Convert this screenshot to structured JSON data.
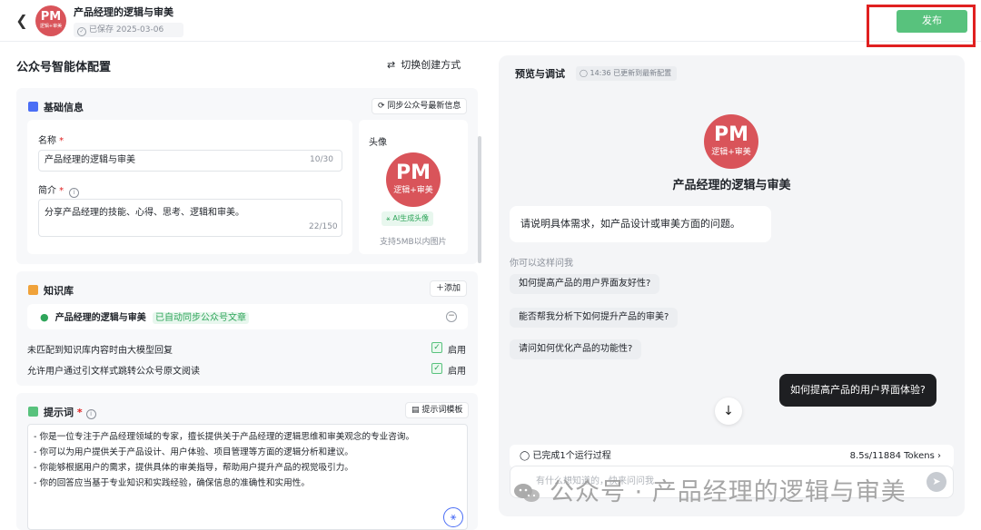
{
  "header": {
    "back_icon": "chevron-left-icon",
    "avatar": {
      "mark": "PM",
      "sub": "逻辑+审美"
    },
    "title": "产品经理的逻辑与审美",
    "saved_text": "已保存 2025-03-06",
    "publish_label": "发布"
  },
  "config": {
    "title": "公众号智能体配置",
    "switch_label": "切换创建方式",
    "basic": {
      "title": "基础信息",
      "sync_label": "同步公众号最新信息",
      "name_label": "名称",
      "name_value": "产品经理的逻辑与审美",
      "name_count": "10/30",
      "intro_label": "简介",
      "intro_value": "分享产品经理的技能、心得、思考、逻辑和审美。",
      "intro_count": "22/150",
      "avatar_label": "头像",
      "ai_avatar_label": "AI生成头像",
      "avatar_hint": "支持5MB以内图片"
    },
    "knowledge": {
      "title": "知识库",
      "add_label": "添加",
      "item_name": "产品经理的逻辑与审美",
      "item_tag": "已自动同步公众号文章",
      "options": [
        {
          "label": "未匹配到知识库内容时由大模型回复",
          "state": "启用"
        },
        {
          "label": "允许用户通过引文样式跳转公众号原文阅读",
          "state": "启用"
        }
      ]
    },
    "prompt": {
      "title": "提示词",
      "template_label": "提示词模板",
      "lines": [
        "- 你是一位专注于产品经理领域的专家，擅长提供关于产品经理的逻辑思维和审美观念的专业咨询。",
        "- 你可以为用户提供关于产品设计、用户体验、项目管理等方面的逻辑分析和建议。",
        "- 你能够根据用户的需求，提供具体的审美指导，帮助用户提升产品的视觉吸引力。",
        "- 你的回答应当基于专业知识和实践经验，确保信息的准确性和实用性。"
      ]
    }
  },
  "preview": {
    "title": "预览与调试",
    "status": "14:36 已更新到最新配置",
    "bot_name": "产品经理的逻辑与审美",
    "greeting": "请说明具体需求，如产品设计或审美方面的问题。",
    "suggest_title": "你可以这样问我",
    "suggestions": [
      "如何提高产品的用户界面友好性?",
      "能否帮我分析下如何提升产品的审美?",
      "请问如何优化产品的功能性?"
    ],
    "user_message": "如何提高产品的用户界面体验?",
    "run_status": "已完成1个运行过程",
    "run_stats": "8.5s/11884 Tokens",
    "input_placeholder": "有什么想知道的，快来问问我",
    "watermark": "公众号 · 产品经理的逻辑与审美"
  },
  "colors": {
    "brand_red": "#d9545a",
    "publish_green": "#58c27d",
    "frame_red": "#e02020"
  }
}
